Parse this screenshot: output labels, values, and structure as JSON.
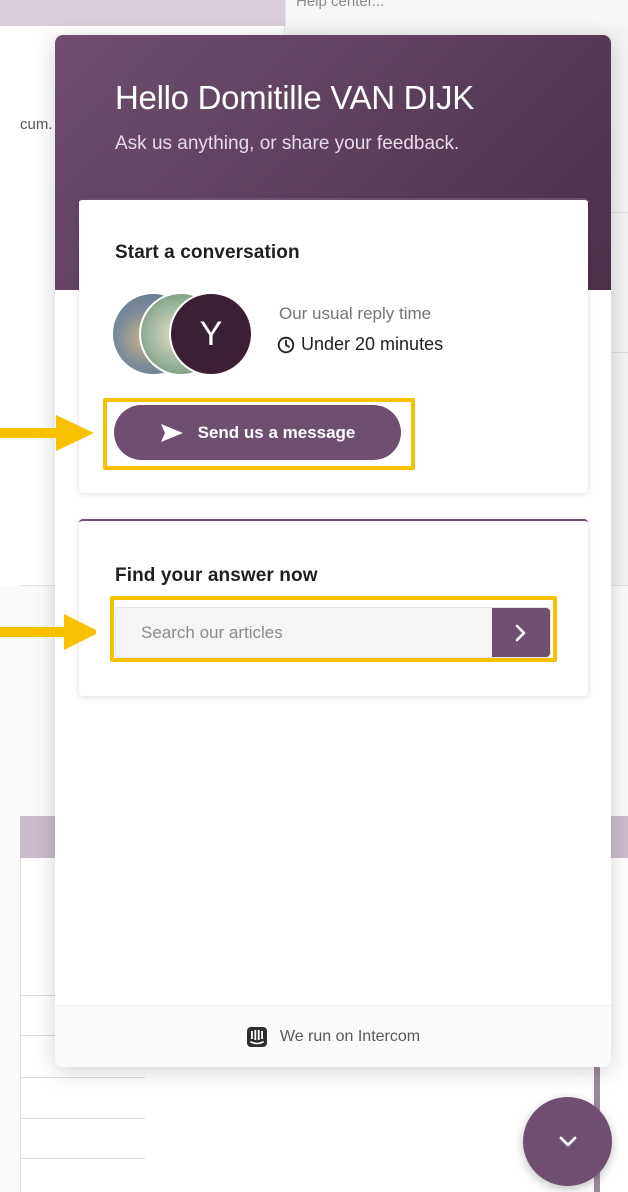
{
  "background": {
    "help_text": "Help center...",
    "snippet_text": "cum."
  },
  "messenger": {
    "greeting": "Hello Domitille VAN DIJK",
    "subtitle": "Ask us anything, or share your feedback.",
    "conversation_card": {
      "title": "Start a conversation",
      "avatars": [
        {
          "type": "photo"
        },
        {
          "type": "photo"
        },
        {
          "type": "initial",
          "letter": "Y"
        }
      ],
      "reply_label": "Our usual reply time",
      "reply_time": "Under 20 minutes",
      "send_button_label": "Send us a message"
    },
    "search_card": {
      "title": "Find your answer now",
      "search_placeholder": "Search our articles"
    },
    "footer_text": "We run on Intercom"
  },
  "icons": {
    "clock": "clock-icon",
    "send": "send-icon",
    "search_submit": "chevron-right-icon",
    "intercom": "intercom-logo-icon",
    "launcher": "chevron-down-icon"
  },
  "colors": {
    "brand": "#6f4e6f",
    "header_dark": "#4d2f48",
    "highlight": "#f7c100"
  }
}
